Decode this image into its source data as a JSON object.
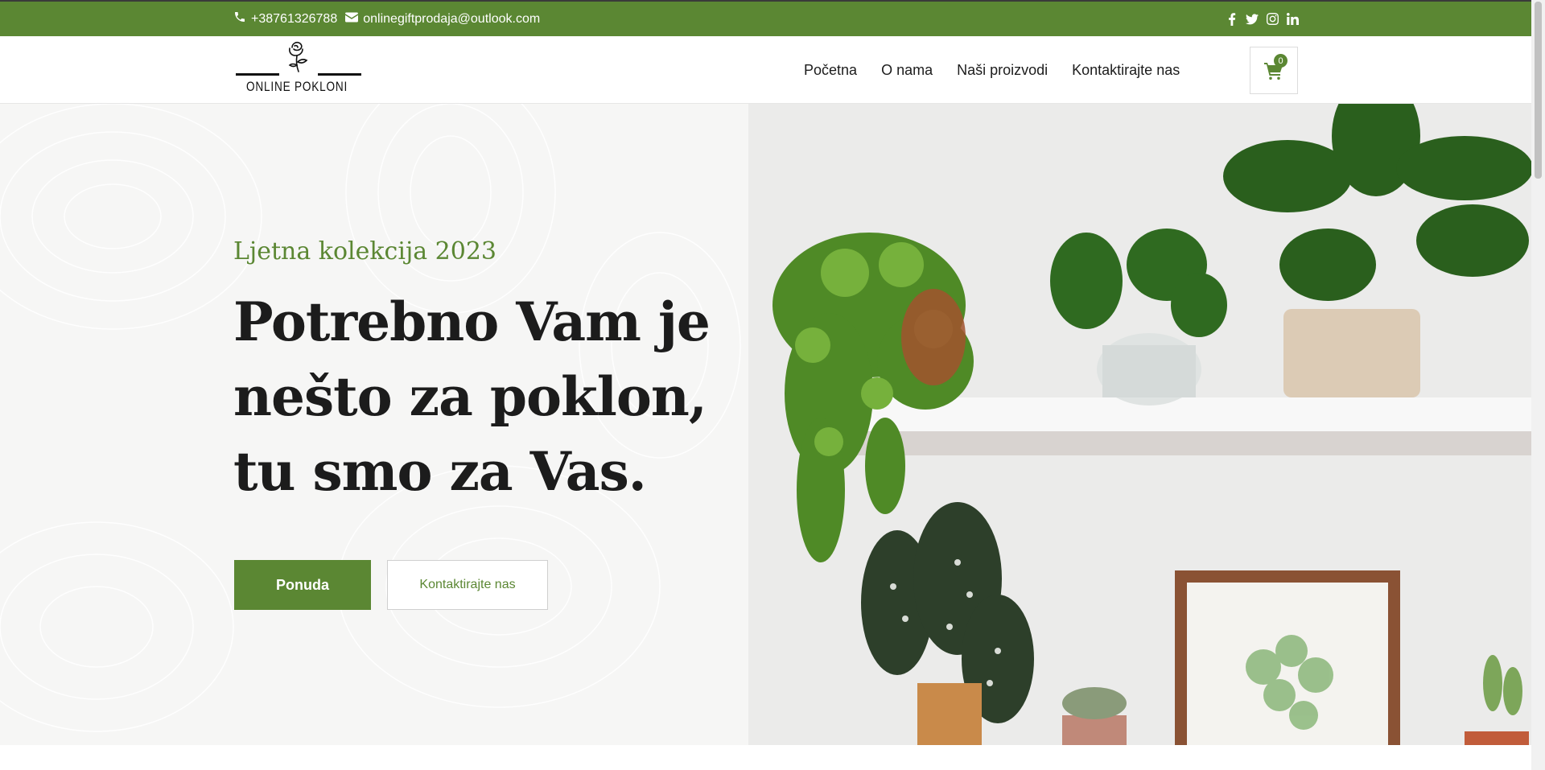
{
  "topbar": {
    "phone": "+38761326788",
    "email": "onlinegiftprodaja@outlook.com",
    "socials": [
      "facebook-icon",
      "twitter-icon",
      "instagram-icon",
      "linkedin-icon"
    ],
    "bg_color": "#5b8733"
  },
  "header": {
    "logo_text": "ONLINE POKLONI",
    "nav": [
      "Početna",
      "O nama",
      "Naši proizvodi",
      "Kontaktirajte nas"
    ],
    "cart_count": "0"
  },
  "hero": {
    "subtitle": "Ljetna kolekcija 2023",
    "headline": "Potrebno Vam je nešto za poklon, tu smo za Vas.",
    "primary_button": "Ponuda",
    "secondary_button": "Kontaktirajte nas",
    "accent_color": "#5b8733"
  }
}
